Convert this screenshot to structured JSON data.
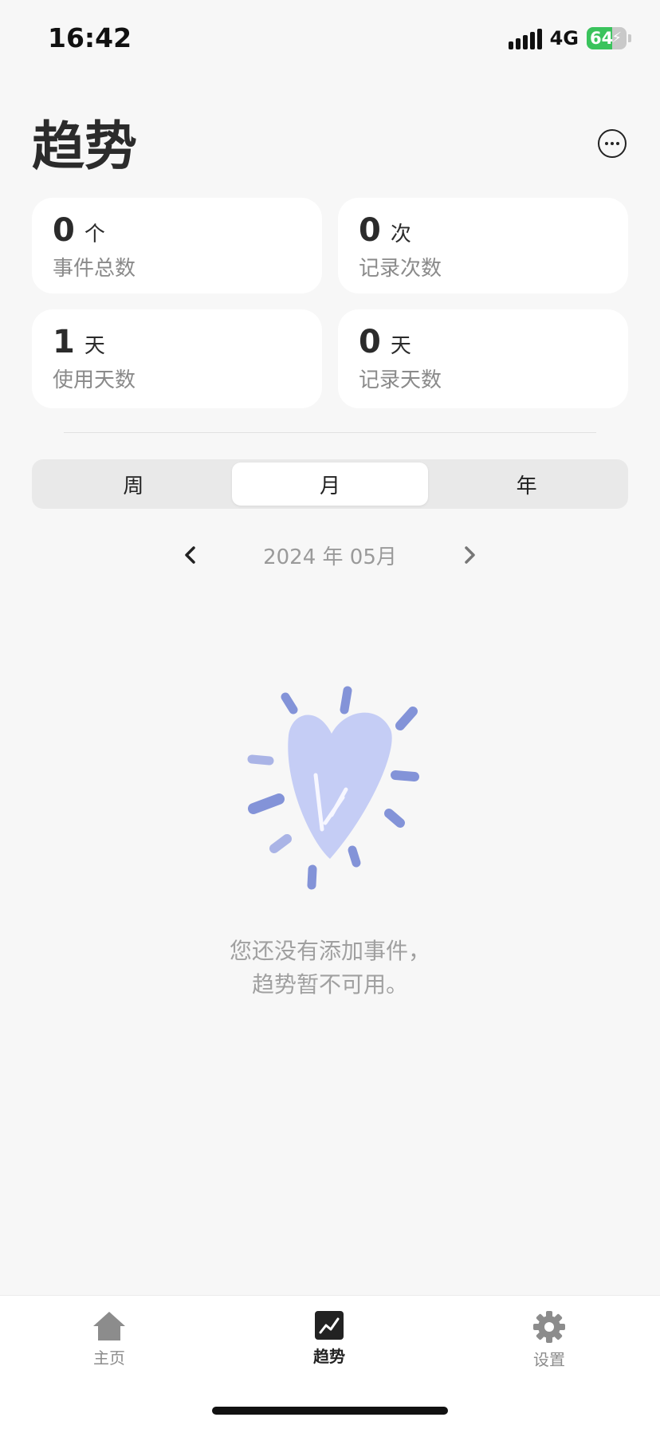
{
  "status": {
    "time": "16:42",
    "network": "4G",
    "battery": "64"
  },
  "header": {
    "title": "趋势"
  },
  "stats": [
    {
      "value": "0",
      "unit": "个",
      "label": "事件总数"
    },
    {
      "value": "0",
      "unit": "次",
      "label": "记录次数"
    },
    {
      "value": "1",
      "unit": "天",
      "label": "使用天数"
    },
    {
      "value": "0",
      "unit": "天",
      "label": "记录天数"
    }
  ],
  "segments": {
    "week": "周",
    "month": "月",
    "year": "年",
    "selected": "月"
  },
  "date_nav": {
    "label": "2024 年 05月"
  },
  "empty_state": {
    "line1": "您还没有添加事件，",
    "line2": "趋势暂不可用。"
  },
  "tabbar": {
    "home": "主页",
    "trends": "趋势",
    "settings": "设置"
  },
  "colors": {
    "accent_heart": "#c5cdf5",
    "accent_strokes": "#8393d8",
    "battery_green": "#3ac35c"
  }
}
